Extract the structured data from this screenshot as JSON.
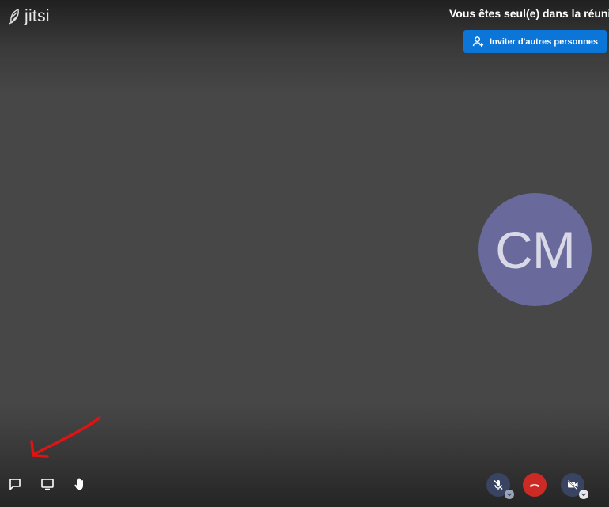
{
  "brand": {
    "name": "jitsi"
  },
  "notice": {
    "text": "Vous êtes seul(e) dans la réunion"
  },
  "invite": {
    "label": "Inviter d'autres personnes",
    "color": "#0b76d8"
  },
  "participant": {
    "initials": "CM",
    "avatar_color": "#69699c"
  },
  "toolbar": {
    "left": [
      {
        "name": "chat",
        "icon": "chat-icon"
      },
      {
        "name": "screenshare",
        "icon": "screen-share-icon"
      },
      {
        "name": "raise-hand",
        "icon": "raise-hand-icon"
      }
    ],
    "right": [
      {
        "name": "microphone",
        "icon": "mic-muted-icon"
      },
      {
        "name": "hangup",
        "icon": "hangup-icon",
        "color": "#cc2a24"
      },
      {
        "name": "camera",
        "icon": "camera-off-icon"
      }
    ]
  },
  "annotation": {
    "icon": "red-arrow-annotation",
    "color": "#e01212"
  }
}
